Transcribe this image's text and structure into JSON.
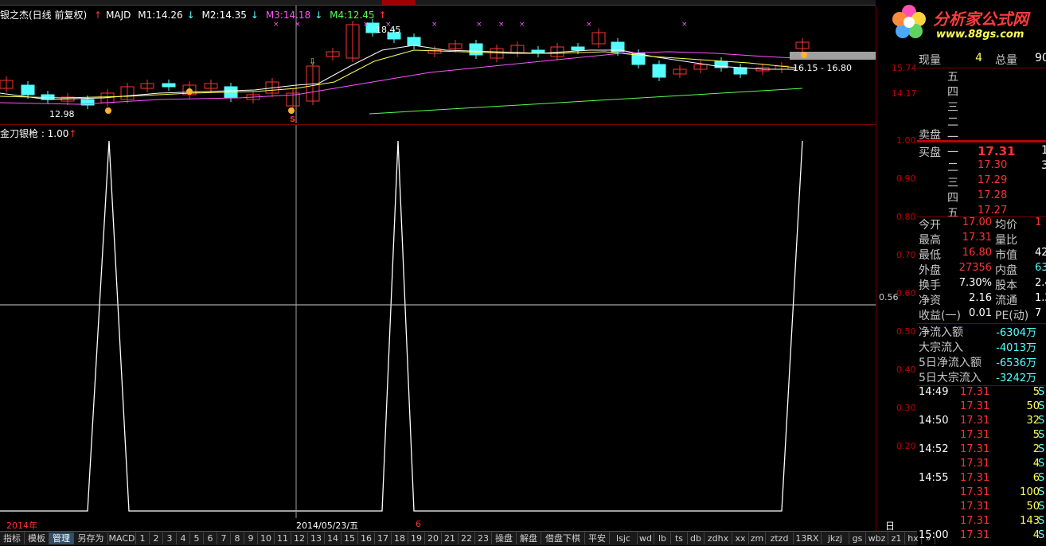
{
  "window": {
    "title": "银之杰(日线 前复权)"
  },
  "legend": {
    "ma_label": "MAJD",
    "m1": "M1:14.26",
    "m2": "M2:14.35",
    "m3": "M3:14.18",
    "m4": "M4:12.45"
  },
  "price_annotations": {
    "high": "18.45",
    "low": "12.98",
    "range": "16.15 - 16.80",
    "signal": "S"
  },
  "price_axis": [
    "15.74",
    "14.17"
  ],
  "indicator": {
    "title": "金刀银枪 : 1.00",
    "axis": [
      "1.00",
      "0.90",
      "0.80",
      "0.70",
      "0.60",
      "0.50",
      "0.40",
      "0.30",
      "0.20"
    ],
    "crosshair_value": "0.56",
    "series": [
      0,
      0,
      1,
      0,
      0,
      0,
      0,
      0,
      0,
      0,
      0,
      0,
      0,
      0,
      1,
      0,
      0,
      0,
      0,
      0,
      0,
      0,
      0,
      0,
      0,
      0,
      0,
      0,
      0,
      0,
      0,
      0,
      0,
      0,
      0,
      0,
      0,
      0,
      0,
      1
    ]
  },
  "date_bar": {
    "year": "2014年",
    "current": "2014/05/23/五",
    "marker": "6",
    "period": "日线"
  },
  "logo": {
    "name": "分析家公式网",
    "url_text": "www.88gs.com"
  },
  "quote": {
    "volume_label": "现量",
    "volume": "4",
    "total_label": "总量",
    "total": "90",
    "sell_label": "卖盘",
    "buy_label": "买盘",
    "sell": [
      {
        "level": "五"
      },
      {
        "level": "四"
      },
      {
        "level": "三"
      },
      {
        "level": "二"
      },
      {
        "level": "一"
      }
    ],
    "buy": [
      {
        "level": "一",
        "price": "17.31",
        "vol": "1"
      },
      {
        "level": "二",
        "price": "17.30",
        "vol": "3"
      },
      {
        "level": "三",
        "price": "17.29",
        "vol": ""
      },
      {
        "level": "四",
        "price": "17.28",
        "vol": ""
      },
      {
        "level": "五",
        "price": "17.27",
        "vol": ""
      }
    ],
    "stats": [
      {
        "k": "今开",
        "v": "17.00",
        "c": "red",
        "k2": "均价",
        "v2": "1",
        "c2": "red"
      },
      {
        "k": "最高",
        "v": "17.31",
        "c": "red",
        "k2": "量比",
        "v2": "",
        "c2": "white"
      },
      {
        "k": "最低",
        "v": "16.80",
        "c": "red",
        "k2": "市值",
        "v2": "42",
        "c2": "white"
      },
      {
        "k": "外盘",
        "v": "27356",
        "c": "red",
        "k2": "内盘",
        "v2": "63",
        "c2": "cyan"
      },
      {
        "k": "换手",
        "v": "7.30%",
        "c": "white",
        "k2": "股本",
        "v2": "2.4",
        "c2": "white"
      },
      {
        "k": "净资",
        "v": "2.16",
        "c": "white",
        "k2": "流通",
        "v2": "1.2",
        "c2": "white"
      },
      {
        "k": "收益(一)",
        "v": "0.01",
        "c": "white",
        "k2": "PE(动)",
        "v2": "7",
        "c2": "white"
      }
    ],
    "flows": [
      {
        "k": "净流入额",
        "v": "-6304万"
      },
      {
        "k": "大宗流入",
        "v": "-4013万"
      },
      {
        "k": "5日净流入额",
        "v": "-6536万"
      },
      {
        "k": "5日大宗流入",
        "v": "-3242万"
      }
    ],
    "ticks": [
      {
        "t": "14:49",
        "p": "17.31",
        "v": "5",
        "s": "S"
      },
      {
        "t": "",
        "p": "17.31",
        "v": "50",
        "s": "S"
      },
      {
        "t": "14:50",
        "p": "17.31",
        "v": "32",
        "s": "S"
      },
      {
        "t": "",
        "p": "17.31",
        "v": "5",
        "s": "S"
      },
      {
        "t": "14:52",
        "p": "17.31",
        "v": "2",
        "s": "S"
      },
      {
        "t": "",
        "p": "17.31",
        "v": "4",
        "s": "S"
      },
      {
        "t": "14:55",
        "p": "17.31",
        "v": "6",
        "s": "S"
      },
      {
        "t": "",
        "p": "17.31",
        "v": "100",
        "s": "S"
      },
      {
        "t": "",
        "p": "17.31",
        "v": "50",
        "s": "S"
      },
      {
        "t": "",
        "p": "17.31",
        "v": "143",
        "s": "S"
      },
      {
        "t": "15:00",
        "p": "17.31",
        "v": "4",
        "s": "S"
      }
    ]
  },
  "bottom_tabs": [
    "指标",
    "模板",
    "管理",
    "另存为",
    "MACD",
    "1",
    "2",
    "3",
    "4",
    "5",
    "6",
    "7",
    "8",
    "9",
    "10",
    "11",
    "12",
    "13",
    "14",
    "15",
    "16",
    "17",
    "18",
    "19",
    "20",
    "21",
    "22",
    "23",
    "操盘",
    "解盘",
    "借盘下棋",
    "平安",
    "lsjc",
    "wd",
    "lb",
    "ts",
    "db",
    "zdhx",
    "xx",
    "zm",
    "ztzd",
    "13RX",
    "jkzj",
    "gs",
    "wbz",
    "z1",
    "hx",
    "»"
  ],
  "colors": {
    "up": "#ff3232",
    "down": "#54ffff",
    "grid": "#7a0000",
    "indicator": "#ffffff"
  }
}
